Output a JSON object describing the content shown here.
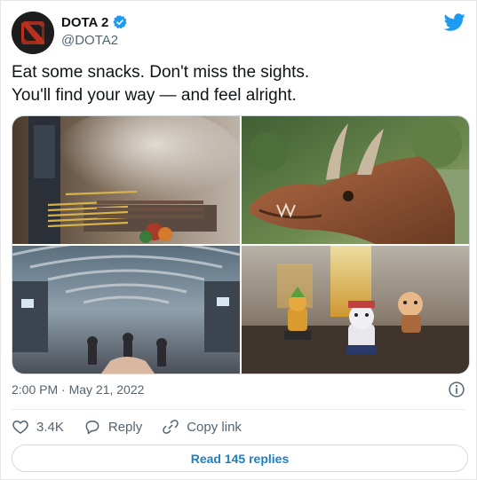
{
  "author": {
    "name": "DOTA 2",
    "handle": "@DOTA2",
    "verified": true
  },
  "tweet": {
    "text": "Eat some snacks. Don't miss the sights.\nYou'll find your way — and feel alright.",
    "timestamp": "2:00 PM · May 21, 2022"
  },
  "media": [
    {
      "name": "photo-grill-skewers"
    },
    {
      "name": "photo-dragon-statue"
    },
    {
      "name": "photo-market-hall"
    },
    {
      "name": "photo-figurines-drinks"
    }
  ],
  "actions": {
    "like_count": "3.4K",
    "reply_label": "Reply",
    "copy_label": "Copy link"
  },
  "read_replies_label": "Read 145 replies",
  "colors": {
    "twitter_blue": "#1d9bf0",
    "like_icon": "#536471",
    "link_blue": "#1d7fc4"
  },
  "icons": [
    "dota-logo-icon",
    "verified-badge-icon",
    "twitter-bird-icon",
    "info-icon",
    "heart-icon",
    "reply-icon",
    "link-icon"
  ]
}
